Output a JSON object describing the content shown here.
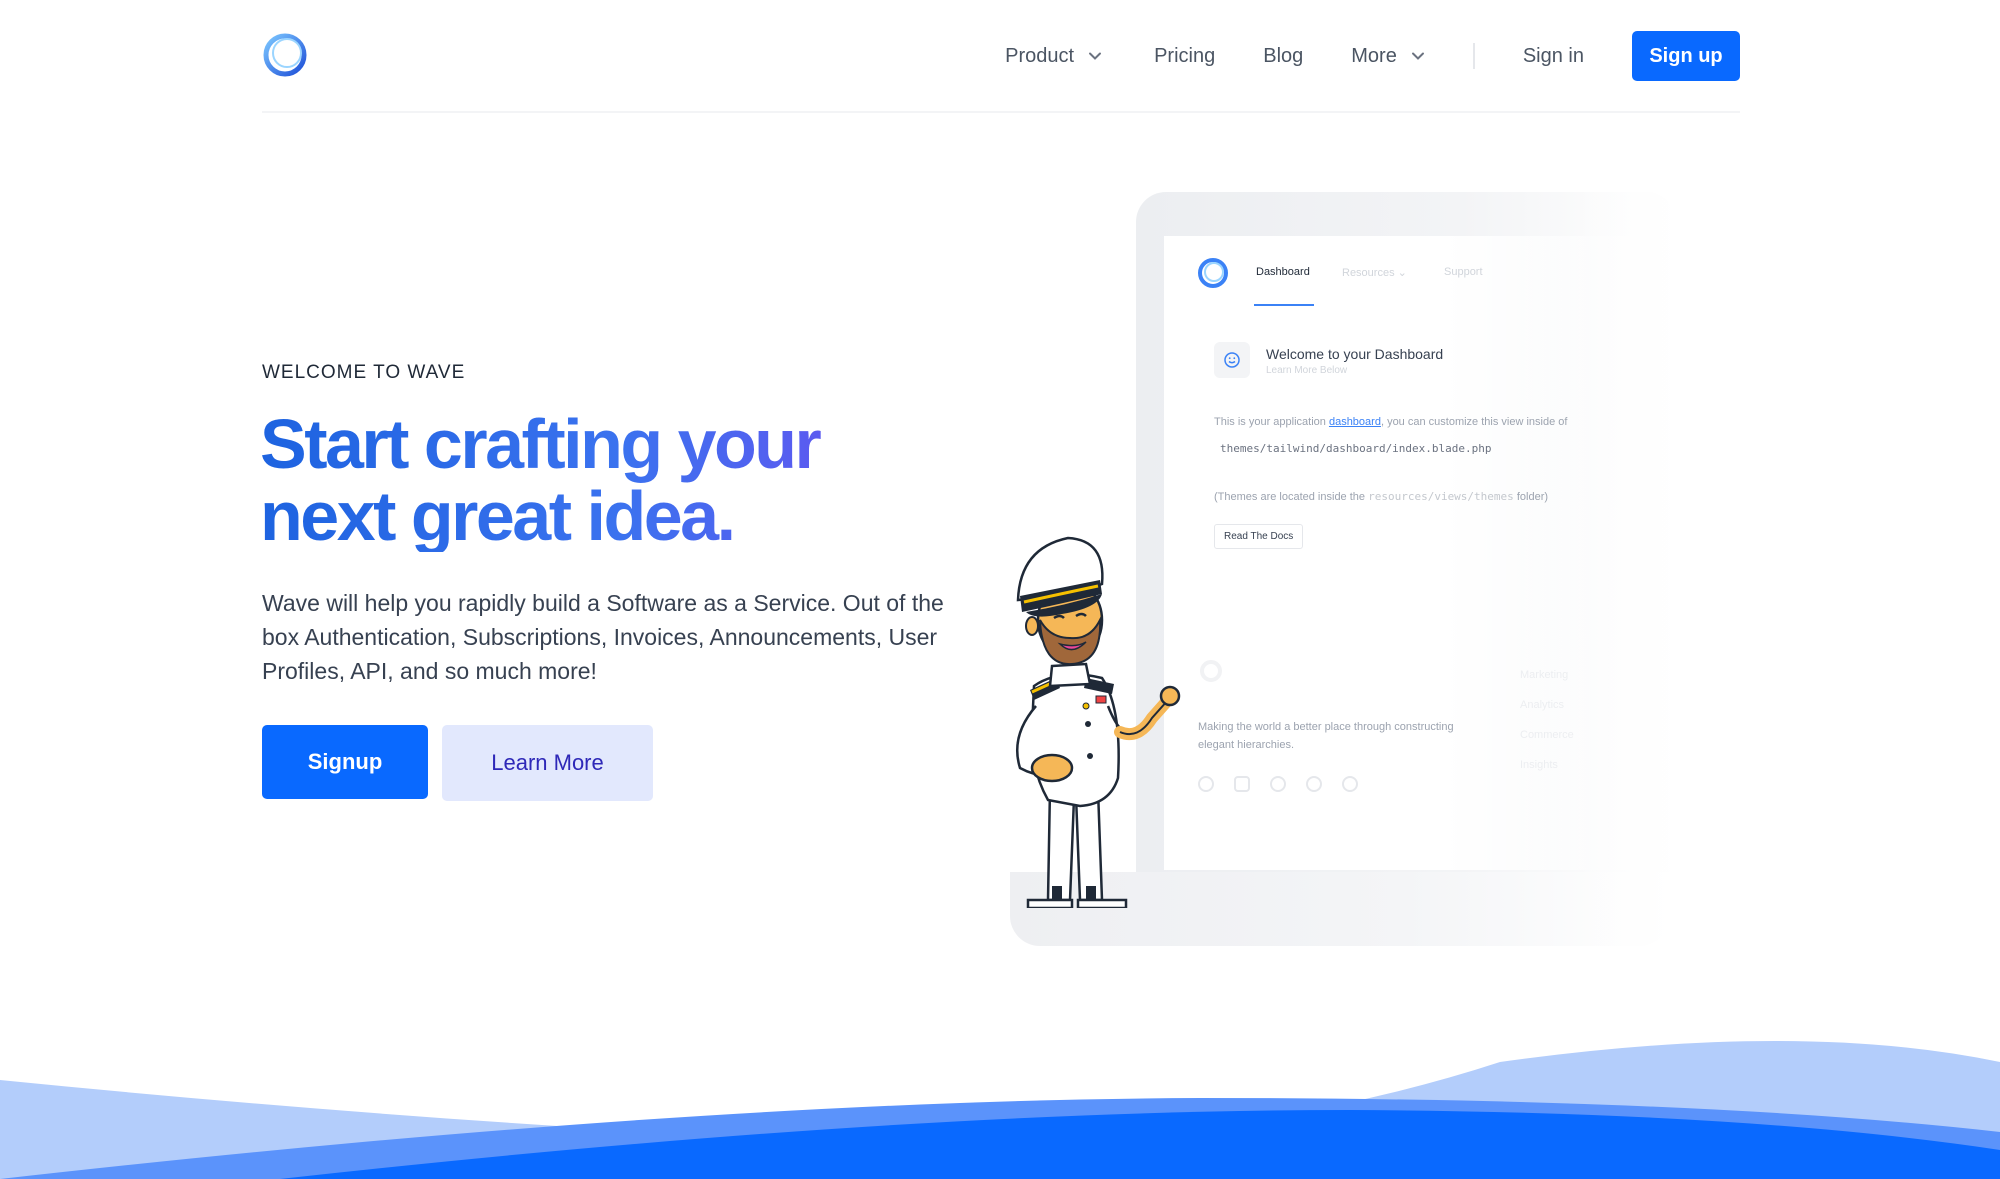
{
  "header": {
    "nav": {
      "product": "Product",
      "pricing": "Pricing",
      "blog": "Blog",
      "more": "More",
      "sign_in": "Sign in",
      "sign_up": "Sign up"
    }
  },
  "hero": {
    "eyebrow": "WELCOME TO WAVE",
    "headline_line1": "Start crafting your",
    "headline_line2": "next great idea.",
    "description": "Wave will help you rapidly build a Software as a Service. Out of the box Authentication, Subscriptions, Invoices, Announcements, User Profiles, API, and so much more!",
    "primary_button": "Signup",
    "secondary_button": "Learn More"
  },
  "mockup": {
    "nav": [
      "Dashboard",
      "Resources",
      "Support"
    ],
    "card_title": "Welcome to your Dashboard",
    "card_subtitle": "Learn More Below",
    "text_before_link": "This is your application ",
    "link_text": "dashboard",
    "text_after_link": ", you can customize this view inside of",
    "code_path": "themes/tailwind/dashboard/index.blade.php",
    "themes_note_prefix": "(Themes are located inside the ",
    "themes_note_code": "resources/views/themes",
    "themes_note_suffix": " folder)",
    "read_docs": "Read The Docs",
    "footer_text": "Making the world a better place through constructing elegant hierarchies.",
    "footer_links": [
      "Marketing",
      "Analytics",
      "Commerce",
      "Insights"
    ]
  },
  "colors": {
    "primary": "#0969ff",
    "secondary_bg": "#e2e8fd",
    "secondary_text": "#2e28b8",
    "wave_light": "#b3cdfb",
    "wave_mid": "#5b93fb",
    "wave_dark": "#0969ff"
  }
}
